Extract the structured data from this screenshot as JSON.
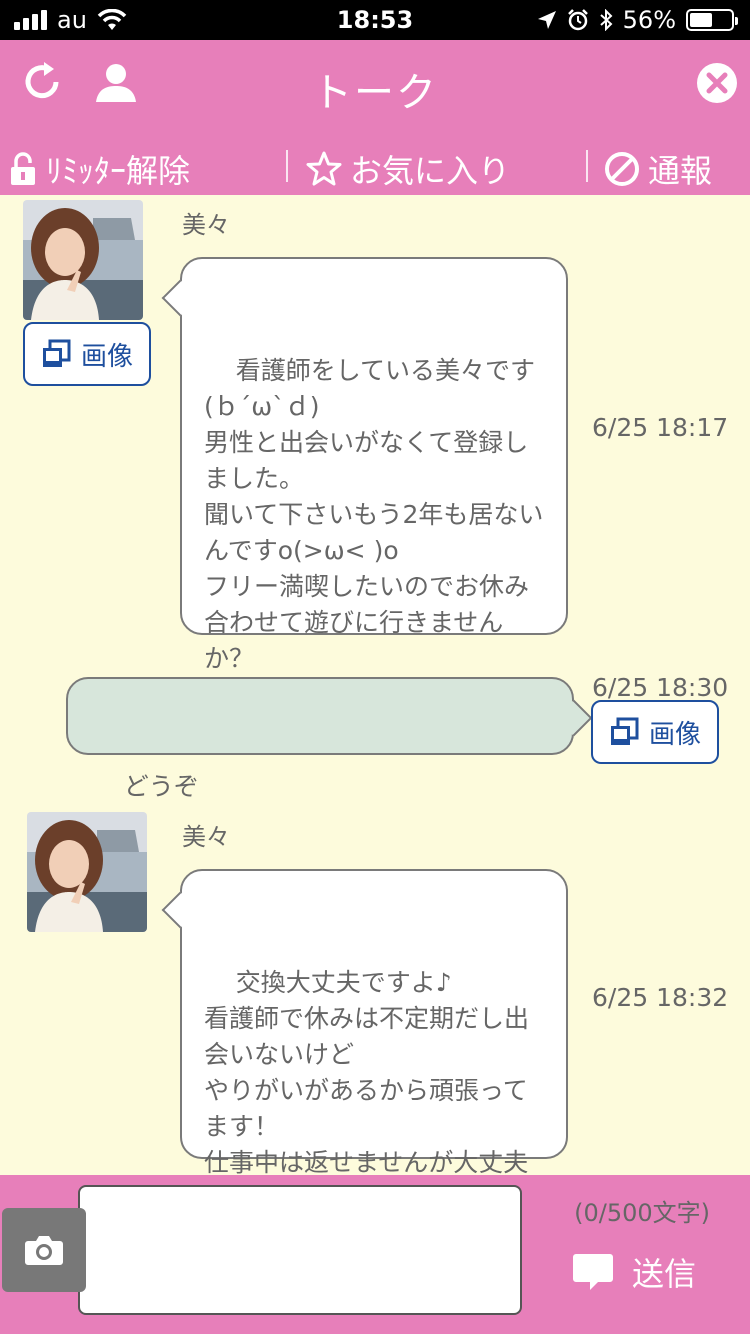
{
  "status_bar": {
    "carrier": "au",
    "time": "18:53",
    "battery": "56%"
  },
  "header": {
    "title": "トーク",
    "toolbar": {
      "limiter_label": "ﾘﾐｯﾀｰ解除",
      "favorite_label": "お気に入り",
      "report_label": "通報"
    }
  },
  "messages": [
    {
      "sender": "美々",
      "image_button": "画像",
      "text": "看護師をしている美々です\n(ｂ´ω`ｄ)\n男性と出会いがなくて登録しました。\n聞いて下さいもう2年も居ないんですo(>ω< )o\nフリー満喫したいのでお休み合わせて遊びに行きませんか？",
      "time": "6/25 18:17"
    },
    {
      "text": "どうぞ",
      "time": "6/25 18:30",
      "image_button": "画像"
    },
    {
      "sender": "美々",
      "text": "交換大丈夫ですよ♪\n看護師で休みは不定期だし出会いないけど\nやりがいがあるから頑張ってます！\n仕事中は返せませんが大丈夫ですか？",
      "time": "6/25 18:32"
    }
  ],
  "composer": {
    "input_value": "",
    "char_count": "(0/500文字)",
    "send_label": "送信"
  },
  "colors": {
    "header": "#e77fba",
    "chat_bg": "#fdfbdc",
    "my_bubble": "#d7e6db",
    "image_button": "#1e4f9e"
  }
}
